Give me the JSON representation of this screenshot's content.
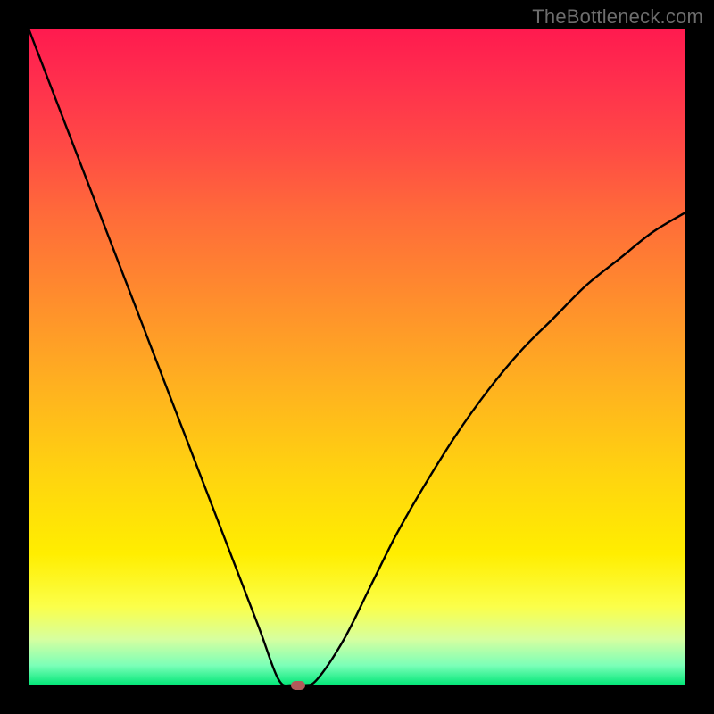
{
  "watermark": "TheBottleneck.com",
  "colors": {
    "frame": "#000000",
    "curve": "#000000",
    "marker": "#b25a5a",
    "gradient_top": "#ff1a4f",
    "gradient_bottom": "#00e676"
  },
  "chart_data": {
    "type": "line",
    "title": "",
    "xlabel": "",
    "ylabel": "",
    "xlim": [
      0,
      100
    ],
    "ylim": [
      0,
      100
    ],
    "grid": false,
    "legend": false,
    "series": [
      {
        "name": "bottleneck-curve",
        "x": [
          0,
          5,
          10,
          15,
          20,
          25,
          30,
          35,
          38,
          40,
          42,
          44,
          48,
          52,
          56,
          60,
          65,
          70,
          75,
          80,
          85,
          90,
          95,
          100
        ],
        "values": [
          100,
          87,
          74,
          61,
          48,
          35,
          22,
          9,
          1,
          0,
          0,
          1,
          7,
          15,
          23,
          30,
          38,
          45,
          51,
          56,
          61,
          65,
          69,
          72
        ]
      }
    ],
    "annotations": [
      {
        "name": "min-marker",
        "x": 41,
        "y": 0
      }
    ]
  }
}
